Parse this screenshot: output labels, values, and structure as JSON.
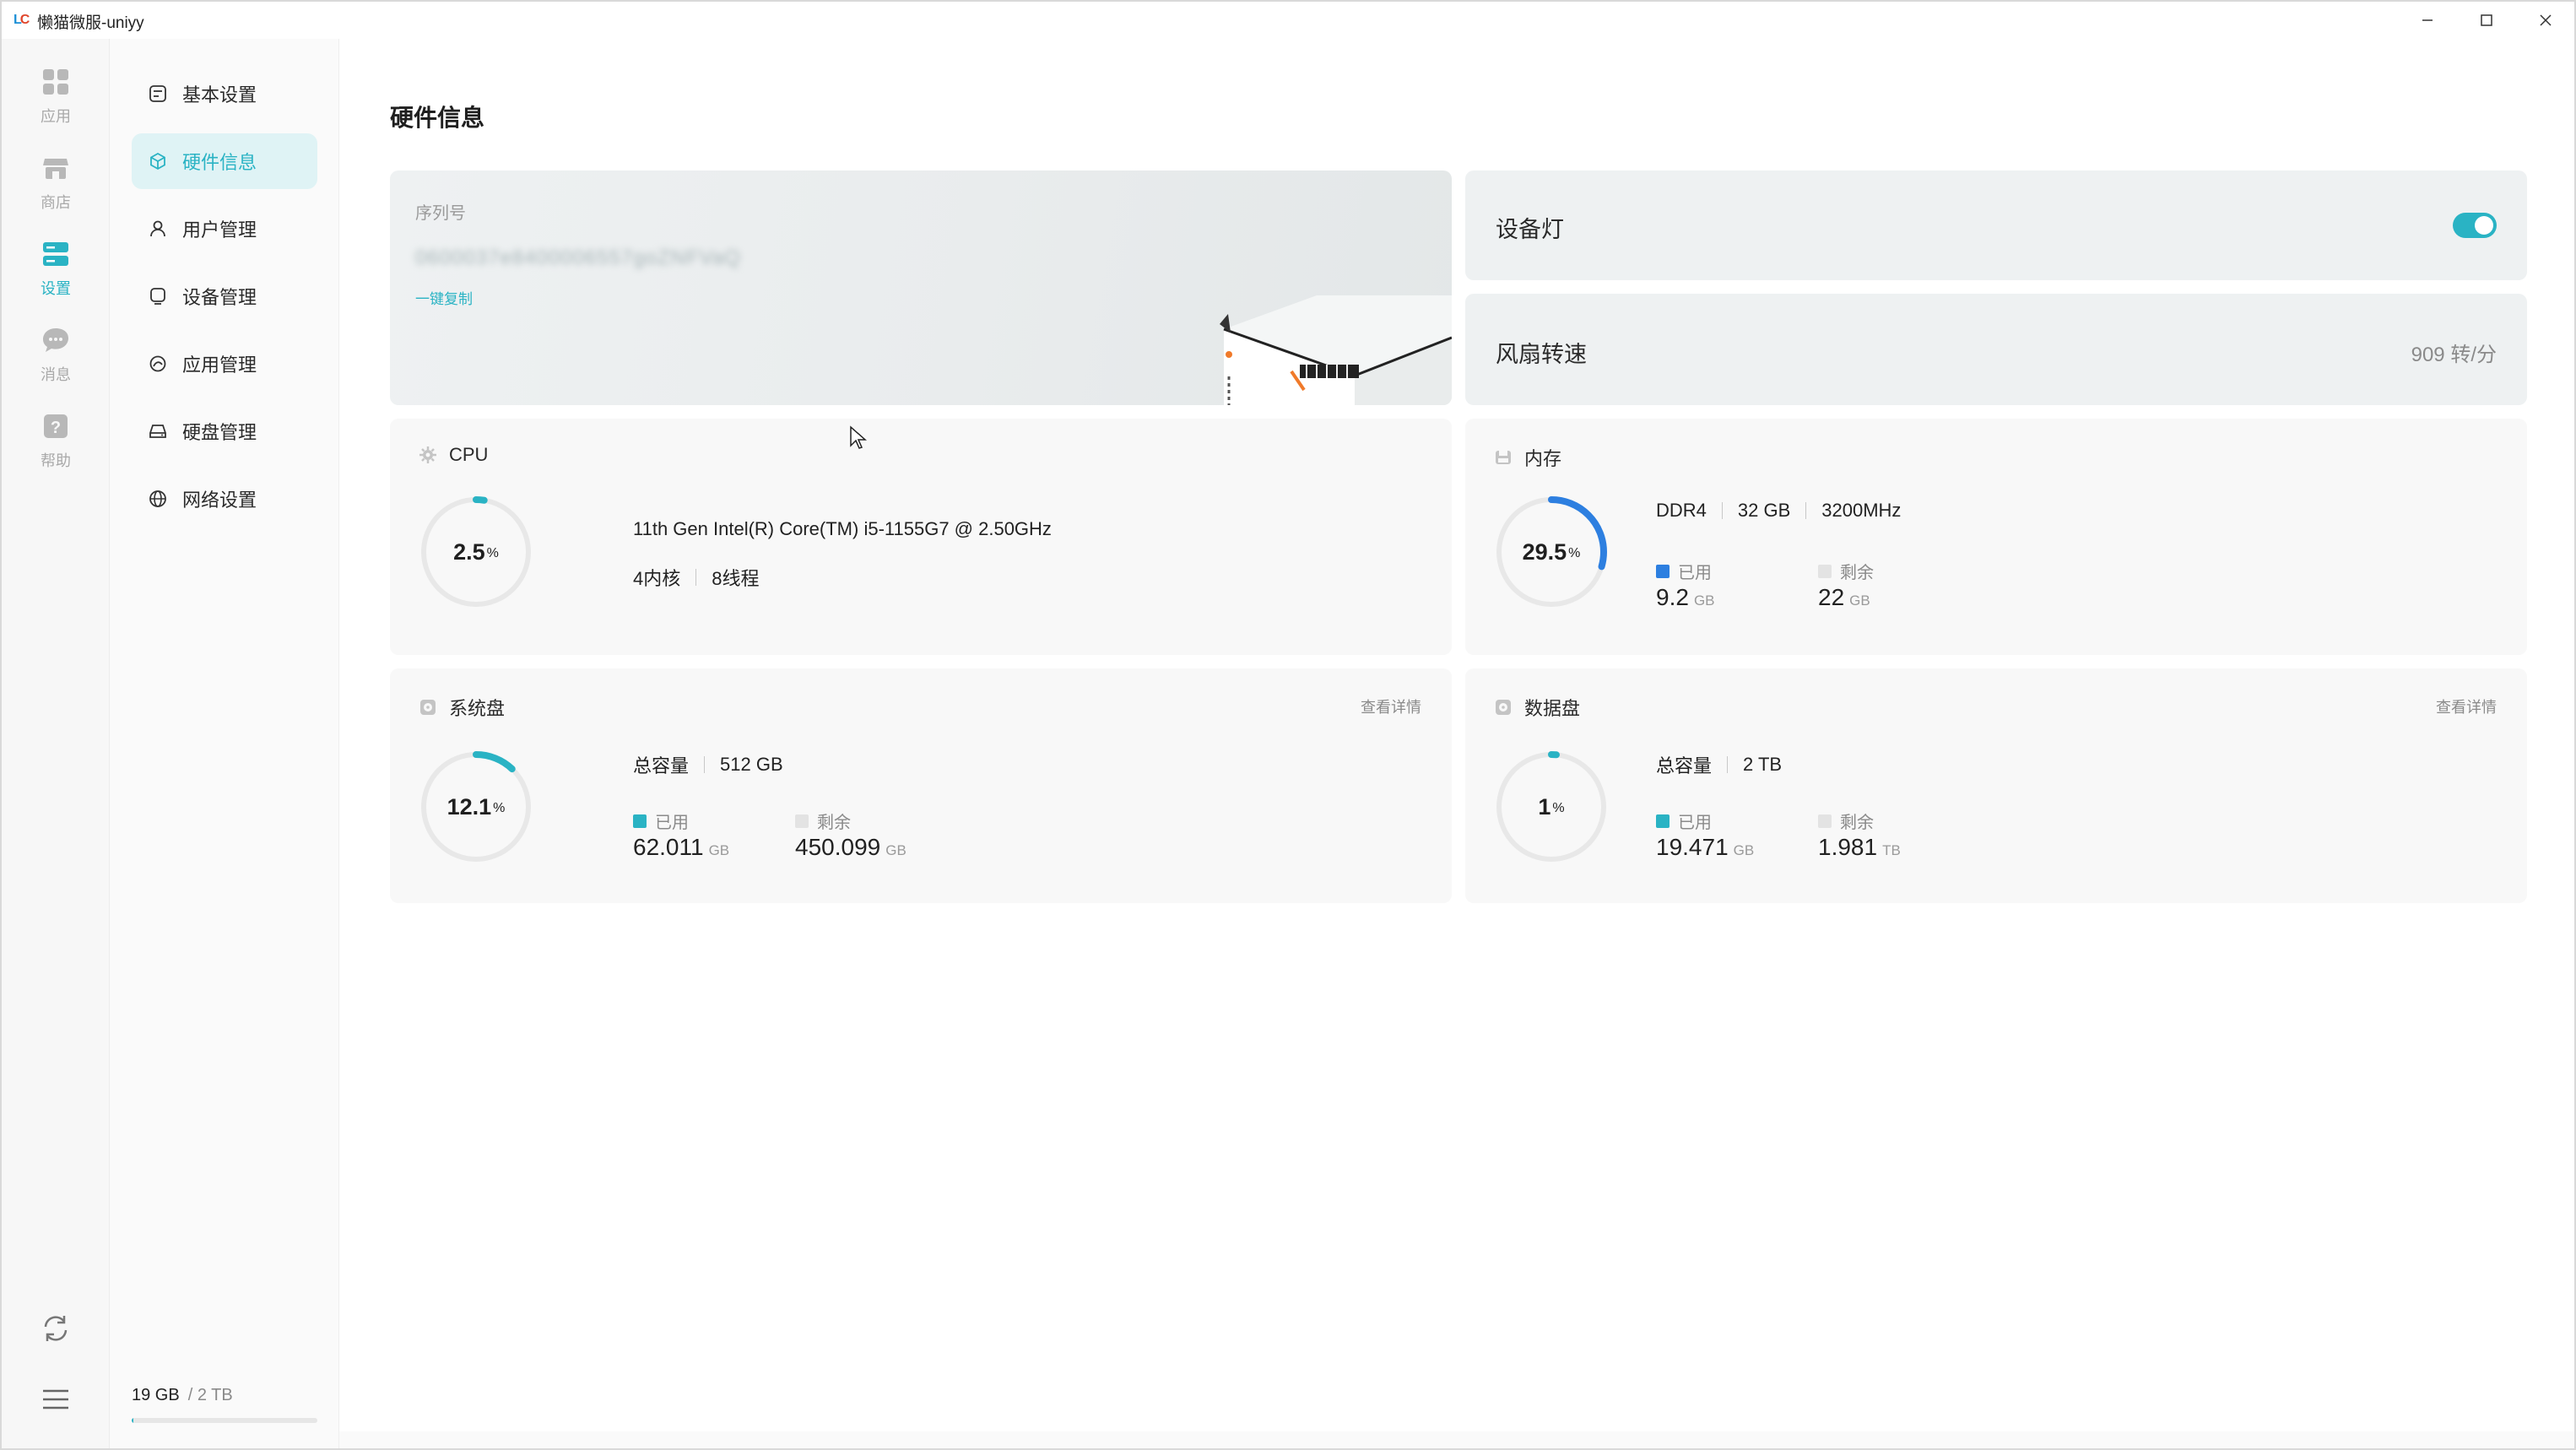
{
  "window": {
    "title": "懒猫微服-uniyy"
  },
  "rail": {
    "items": [
      {
        "label": "应用",
        "icon": "apps-grid-icon"
      },
      {
        "label": "商店",
        "icon": "store-icon"
      },
      {
        "label": "设置",
        "icon": "settings-icon"
      },
      {
        "label": "消息",
        "icon": "message-icon"
      },
      {
        "label": "帮助",
        "icon": "help-icon"
      }
    ]
  },
  "sidebar": {
    "items": [
      {
        "label": "基本设置",
        "icon": "basic-settings-icon"
      },
      {
        "label": "硬件信息",
        "icon": "hardware-cube-icon"
      },
      {
        "label": "用户管理",
        "icon": "user-icon"
      },
      {
        "label": "设备管理",
        "icon": "device-icon"
      },
      {
        "label": "应用管理",
        "icon": "app-manage-icon"
      },
      {
        "label": "硬盘管理",
        "icon": "disk-icon"
      },
      {
        "label": "网络设置",
        "icon": "globe-icon"
      }
    ],
    "storage_used": "19 GB",
    "storage_total": "/ 2 TB",
    "storage_fraction": 0.01
  },
  "page": {
    "title": "硬件信息"
  },
  "serial": {
    "label": "序列号",
    "value": "0600037e8400006557goZNFVaQ",
    "copy_label": "一键复制"
  },
  "device_light": {
    "label": "设备灯",
    "enabled": true
  },
  "fan": {
    "label": "风扇转速",
    "value": "909 转/分"
  },
  "cpu": {
    "title": "CPU",
    "usage": "2.5",
    "usage_fraction": 0.025,
    "model": "11th Gen Intel(R) Core(TM) i5-1155G7 @ 2.50GHz",
    "cores": "4内核",
    "threads": "8线程"
  },
  "memory": {
    "title": "内存",
    "usage": "29.5",
    "usage_fraction": 0.295,
    "type": "DDR4",
    "size": "32 GB",
    "freq": "3200MHz",
    "used_label": "已用",
    "used_value": "9.2",
    "used_unit": "GB",
    "free_label": "剩余",
    "free_value": "22",
    "free_unit": "GB"
  },
  "system_disk": {
    "title": "系统盘",
    "detail_link": "查看详情",
    "usage": "12.1",
    "usage_fraction": 0.121,
    "capacity_label": "总容量",
    "capacity": "512 GB",
    "used_label": "已用",
    "used_value": "62.011",
    "used_unit": "GB",
    "free_label": "剩余",
    "free_value": "450.099",
    "free_unit": "GB"
  },
  "data_disk": {
    "title": "数据盘",
    "detail_link": "查看详情",
    "usage": "1",
    "usage_fraction": 0.01,
    "capacity_label": "总容量",
    "capacity": "2 TB",
    "used_label": "已用",
    "used_value": "19.471",
    "used_unit": "GB",
    "free_label": "剩余",
    "free_value": "1.981",
    "free_unit": "TB"
  },
  "common": {
    "percent": "%"
  },
  "colors": {
    "accent": "#2ab3c4",
    "memory": "#2d7fe0",
    "free": "#e3e3e3",
    "ring_track": "#e8e8e8"
  }
}
